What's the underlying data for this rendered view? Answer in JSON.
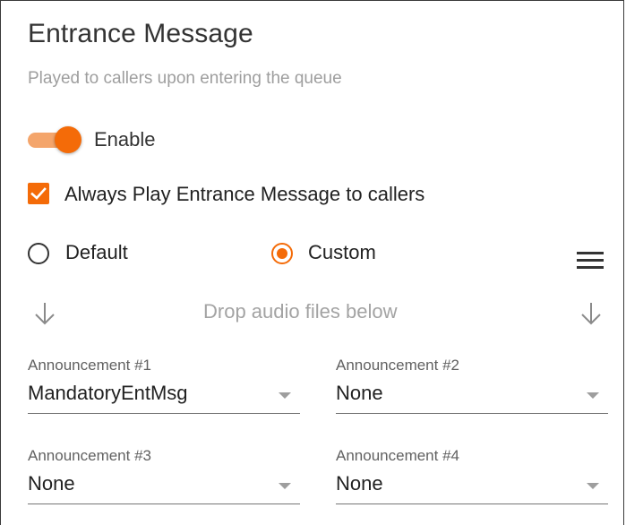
{
  "section": {
    "title": "Entrance Message",
    "subtitle": "Played to callers upon entering the queue"
  },
  "enable_toggle": {
    "label": "Enable",
    "on": true
  },
  "always_play": {
    "label": "Always Play Entrance Message to callers",
    "checked": true
  },
  "source_options": [
    {
      "label": "Default",
      "selected": false
    },
    {
      "label": "Custom",
      "selected": true
    }
  ],
  "drop_zone": {
    "text": "Drop audio files below",
    "icon": "arrow-down-icon"
  },
  "menu": {
    "icon": "hamburger-menu-icon"
  },
  "announcements": [
    {
      "label": "Announcement #1",
      "value": "MandatoryEntMsg"
    },
    {
      "label": "Announcement #2",
      "value": "None"
    },
    {
      "label": "Announcement #3",
      "value": "None"
    },
    {
      "label": "Announcement #4",
      "value": "None"
    }
  ],
  "colors": {
    "accent": "#f46b08",
    "accent_light": "#f4a56b",
    "muted_text": "#9e9e9e"
  }
}
